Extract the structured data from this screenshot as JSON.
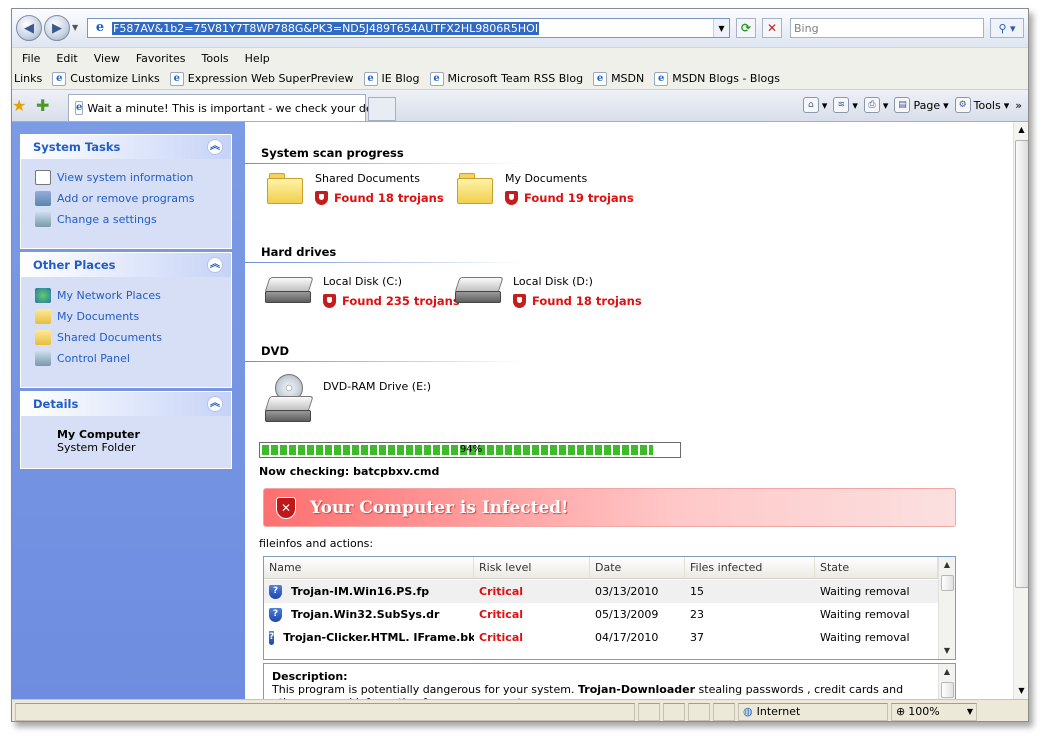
{
  "browser": {
    "address_url": "F587AV&1b2=75V81Y7T8WP788G&PK3=ND5J489T654AUTFX2HL9806R5HOI",
    "search_placeholder": "Bing",
    "menu": [
      "File",
      "Edit",
      "View",
      "Favorites",
      "Tools",
      "Help"
    ],
    "links_label": "Links",
    "links": [
      "Customize Links",
      "Expression Web SuperPreview",
      "IE Blog",
      "Microsoft Team RSS Blog",
      "MSDN",
      "MSDN Blogs - Blogs"
    ],
    "tab_title": "Wait a minute! This is important - we check your device",
    "cmd_page": "Page",
    "cmd_tools": "Tools",
    "status_zone": "Internet",
    "status_zoom": "100%"
  },
  "sidebar": {
    "system_tasks": {
      "title": "System Tasks",
      "items": [
        "View system information",
        "Add or remove programs",
        "Change a settings"
      ]
    },
    "other_places": {
      "title": "Other Places",
      "items": [
        "My Network Places",
        "My Documents",
        "Shared Documents",
        "Control Panel"
      ]
    },
    "details": {
      "title": "Details",
      "name": "My Computer",
      "type": "System Folder"
    }
  },
  "scan": {
    "section1": "System scan progress",
    "folders": [
      {
        "name": "Shared Documents",
        "result": "Found 18 trojans"
      },
      {
        "name": "My Documents",
        "result": "Found 19 trojans"
      }
    ],
    "section2": "Hard drives",
    "drives": [
      {
        "name": "Local Disk (C:)",
        "result": "Found 235 trojans"
      },
      {
        "name": "Local Disk (D:)",
        "result": "Found 18 trojans"
      }
    ],
    "section3": "DVD",
    "dvd": {
      "name": "DVD-RAM Drive (E:)"
    },
    "progress_percent": 94,
    "progress_label": "94%",
    "checking": "Now checking: batcpbxv.cmd",
    "alert": "Your Computer is Infected!",
    "fileinfo_label": "fileinfos and actions:"
  },
  "table": {
    "columns": [
      "Name",
      "Risk level",
      "Date",
      "Files infected",
      "State"
    ],
    "rows": [
      {
        "name": "Trojan-IM.Win16.PS.fp",
        "risk": "Critical",
        "date": "03/13/2010",
        "files": "15",
        "state": "Waiting removal"
      },
      {
        "name": "Trojan.Win32.SubSys.dr",
        "risk": "Critical",
        "date": "05/13/2009",
        "files": "23",
        "state": "Waiting removal"
      },
      {
        "name": "Trojan-Clicker.HTML. IFrame.bk",
        "risk": "Critical",
        "date": "04/17/2010",
        "files": "37",
        "state": "Waiting removal"
      }
    ]
  },
  "description": {
    "title": "Description:",
    "text_before": "This program is potentially dangerous for your system.",
    "bold": "Trojan-Downloader",
    "text_after": "stealing passwords , credit cards and other personal information from your computer"
  },
  "colors": {
    "sidebar_bg": "#6f8de0",
    "alert_red": "#e01010",
    "progress_green": "#3dbb2a"
  }
}
